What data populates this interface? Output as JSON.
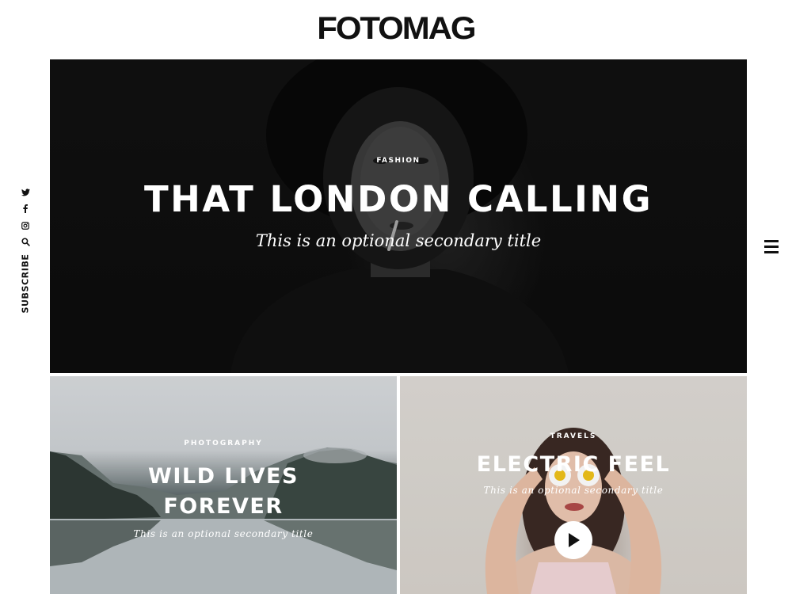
{
  "site": {
    "logo": "FOTOMAG"
  },
  "social": {
    "icons": [
      "twitter-icon",
      "facebook-icon",
      "instagram-icon",
      "search-icon"
    ],
    "subscribe_label": "SUBSCRIBE"
  },
  "menu": {
    "icon": "hamburger-menu-icon"
  },
  "hero": {
    "category": "FASHION",
    "title": "THAT LONDON CALLING",
    "subtitle": "This is an optional secondary title"
  },
  "posts": [
    {
      "category": "PHOTOGRAPHY",
      "title_line1": "WILD LIVES",
      "title_line2": "FOREVER",
      "subtitle": "This is an optional secondary title"
    },
    {
      "category": "TRAVELS",
      "title": "ELECTRIC FEEL",
      "subtitle": "This is an optional secondary title",
      "play_icon": "play-icon"
    }
  ],
  "colors": {
    "text_dark": "#111111",
    "overlay_text": "#ffffff",
    "page_background": "#ffffff"
  }
}
